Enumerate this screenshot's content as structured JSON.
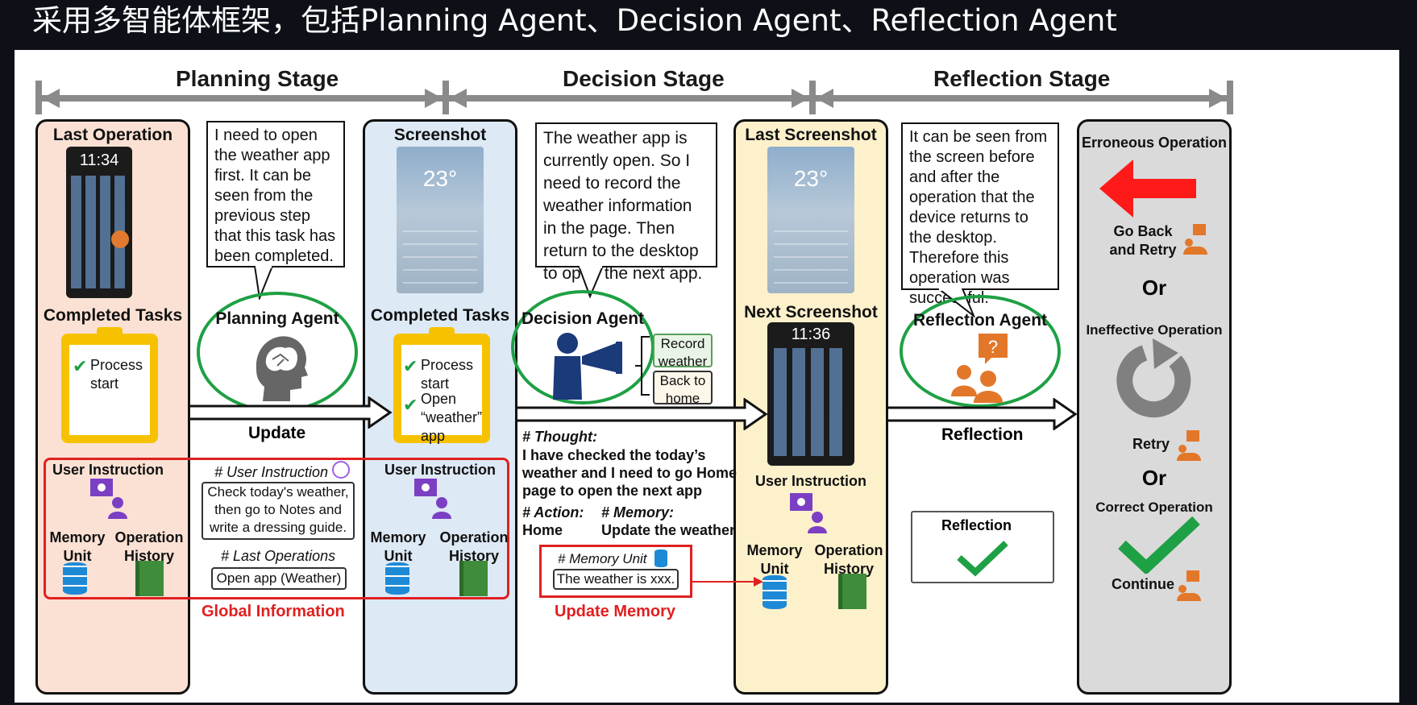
{
  "slide_title": "采用多智能体框架，包括Planning Agent、Decision Agent、Reflection Agent",
  "stages": {
    "planning": "Planning Stage",
    "decision": "Decision Stage",
    "reflection": "Reflection Stage"
  },
  "planning": {
    "last_operation": "Last Operation",
    "phone_time": "11:34",
    "completed_tasks": "Completed Tasks",
    "tasks": [
      "Process start"
    ],
    "bubble": "I need to open the weather app first. It can be seen from the previous step that this task has been completed.",
    "agent": "Planning Agent",
    "update": "Update"
  },
  "decision": {
    "screenshot": "Screenshot",
    "temp": "23°",
    "completed_tasks": "Completed Tasks",
    "tasks": [
      "Process start",
      "Open “weather” app"
    ],
    "bubble": "The weather app is currently open. So I need to record the weather information in the page. Then return to the desktop to open the next app.",
    "agent": "Decision Agent",
    "options": [
      "Record weather",
      "Back to home"
    ],
    "thought_label": "# Thought:",
    "thought": "I have checked the today’s weather and I need to go Home page to open the next app",
    "action_label": "# Action:",
    "action": "Home",
    "memory_label": "# Memory:",
    "memory": "Update the weather",
    "memory_unit_label": "# Memory Unit",
    "memory_unit_value": "The weather is xxx.",
    "update_memory": "Update Memory"
  },
  "reflection": {
    "last_screenshot": "Last Screenshot",
    "temp": "23°",
    "next_screenshot": "Next Screenshot",
    "phone_time": "11:36",
    "bubble": "It can be seen from the screen before and after the operation that the device returns to the desktop. Therefore this operation was successful.",
    "agent": "Reflection Agent",
    "arrow_label": "Reflection",
    "result_box": "Reflection",
    "user_instruction": "User Instruction",
    "memory_unit": "Memory Unit",
    "operation_history": "Operation History"
  },
  "outcomes": {
    "erroneous": "Erroneous Operation",
    "go_back": "Go Back and Retry",
    "or1": "Or",
    "ineffective": "Ineffective Operation",
    "retry": "Retry",
    "or2": "Or",
    "correct": "Correct Operation",
    "continue": "Continue"
  },
  "global": {
    "user_instruction": "User Instruction",
    "memory_unit": "Memory Unit",
    "operation_history": "Operation History",
    "instr_label": "# User Instruction",
    "instr_text": "Check today's weather, then go to Notes and write a dressing guide.",
    "last_ops_label": "# Last Operations",
    "last_ops_value": "Open app (Weather)",
    "global_info": "Global Information"
  },
  "colors": {
    "green": "#1ea044",
    "red": "#e02020",
    "salmon": "#fbe1d4",
    "lightblue": "#dde9f5",
    "cream": "#fdf1cc",
    "grey": "#dadada",
    "orange": "#e2772a",
    "purple": "#7b3fc4"
  }
}
